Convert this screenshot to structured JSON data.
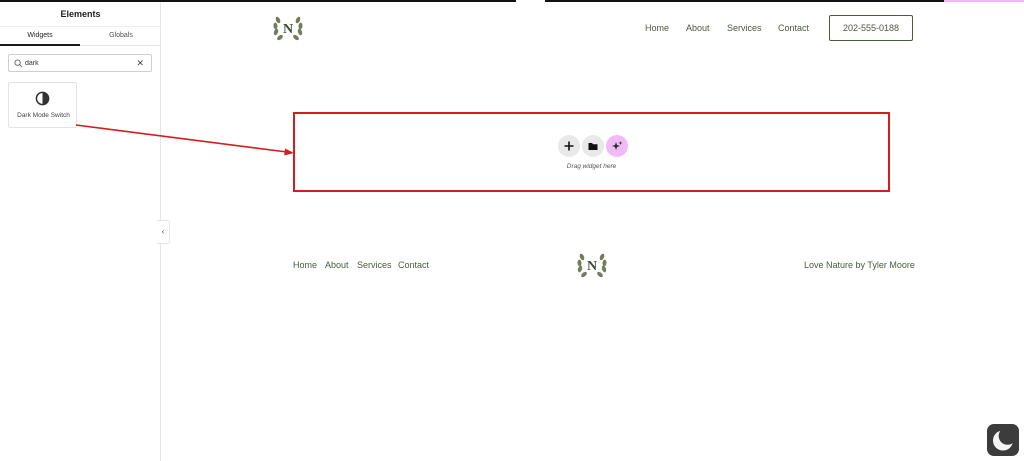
{
  "editor": {
    "panel_title": "Elements",
    "tabs": [
      {
        "label": "Widgets",
        "active": true
      },
      {
        "label": "Globals",
        "active": false
      }
    ],
    "search": {
      "value": "dark",
      "clear_icon": "close-icon"
    },
    "results": [
      {
        "label": "Dark Mode Switch",
        "icon": "contrast-icon"
      }
    ],
    "collapse_icon": "chevron-left-icon"
  },
  "header": {
    "logo_letter": "N",
    "nav": [
      "Home",
      "About",
      "Services",
      "Contact"
    ],
    "phone": "202-555-0188"
  },
  "dropzone": {
    "hint": "Drag widget here",
    "buttons": [
      "plus-icon",
      "folder-icon",
      "ai-sparkle-icon"
    ]
  },
  "footer": {
    "nav": [
      "Home",
      "About",
      "Services",
      "Contact"
    ],
    "logo_letter": "N",
    "credit": "Love Nature by Tyler Moore"
  },
  "colors": {
    "brand_text": "#4b5a3d",
    "highlight_border": "#d61d1d",
    "ai_accent": "#f2b9f7",
    "toggle_bg": "#3c3c3c"
  }
}
